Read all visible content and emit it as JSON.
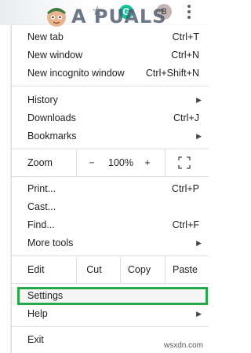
{
  "toolbar": {
    "star_icon": "star-outline-icon",
    "grammarly_letter": "G",
    "avatar_letter": "B",
    "more_icon": "vertical-dots-icon"
  },
  "logo": {
    "text": "A PUALS"
  },
  "menu": {
    "new_tab": {
      "label": "New tab",
      "shortcut": "Ctrl+T"
    },
    "new_window": {
      "label": "New window",
      "shortcut": "Ctrl+N"
    },
    "new_incognito": {
      "label": "New incognito window",
      "shortcut": "Ctrl+Shift+N"
    },
    "history": {
      "label": "History"
    },
    "downloads": {
      "label": "Downloads",
      "shortcut": "Ctrl+J"
    },
    "bookmarks": {
      "label": "Bookmarks"
    },
    "zoom": {
      "label": "Zoom",
      "minus": "−",
      "value": "100%",
      "plus": "+",
      "fullscreen_icon": "fullscreen-icon"
    },
    "print": {
      "label": "Print...",
      "shortcut": "Ctrl+P"
    },
    "cast": {
      "label": "Cast..."
    },
    "find": {
      "label": "Find...",
      "shortcut": "Ctrl+F"
    },
    "more_tools": {
      "label": "More tools"
    },
    "edit": {
      "label": "Edit",
      "cut": "Cut",
      "copy": "Copy",
      "paste": "Paste"
    },
    "settings": {
      "label": "Settings"
    },
    "help": {
      "label": "Help"
    },
    "exit": {
      "label": "Exit"
    }
  },
  "highlight_color": "#23a84a",
  "watermark": "wsxdn.com"
}
